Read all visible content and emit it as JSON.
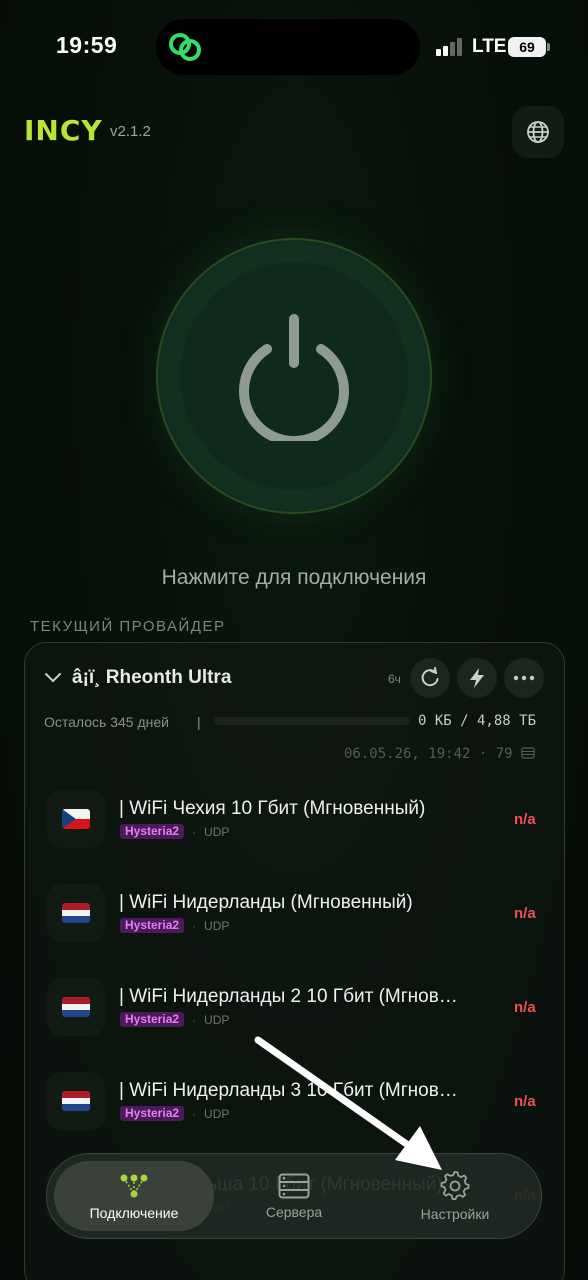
{
  "status_bar": {
    "time": "19:59",
    "network": "LTE",
    "battery": "69"
  },
  "header": {
    "brand": "INCY",
    "version": "v2.1.2"
  },
  "connect": {
    "hint": "Нажмите для подключения"
  },
  "provider": {
    "section_title": "ТЕКУЩИЙ ПРОВАЙДЕР",
    "name": "â¡ï¸ Rheonth Ultra",
    "update_age": "6ч",
    "remaining": "Осталось 345 дней",
    "separator": "|",
    "traffic": "0 КБ / 4,88 ТБ",
    "traffic_used_fraction": 0.0,
    "updated_stamp": "06.05.26, 19:42 · 79"
  },
  "servers": [
    {
      "name": "| WiFi Чехия 10 Гбит (Мгновенный)",
      "protocol": "Hysteria2",
      "network": "UDP",
      "ping": "n/a",
      "flag": "cz"
    },
    {
      "name": "| WiFi Нидерланды (Мгновенный)",
      "protocol": "Hysteria2",
      "network": "UDP",
      "ping": "n/a",
      "flag": "nl"
    },
    {
      "name": "| WiFi Нидерланды 2 10 Гбит (Мгнов…",
      "protocol": "Hysteria2",
      "network": "UDP",
      "ping": "n/a",
      "flag": "nl"
    },
    {
      "name": "| WiFi Нидерланды 3 10 Гбит (Мгнов…",
      "protocol": "Hysteria2",
      "network": "UDP",
      "ping": "n/a",
      "flag": "nl"
    },
    {
      "name": "| WiFi Польша 10 Гбит (Мгновенный)",
      "protocol": "Hysteria2",
      "network": "UDP",
      "ping": "n/a",
      "flag": "pl"
    }
  ],
  "nav": {
    "connection": "Подключение",
    "servers": "Сервера",
    "settings": "Настройки"
  },
  "icons": {
    "island": "link-icon",
    "globe": "globe-icon",
    "power": "power-icon",
    "refresh": "refresh-icon",
    "bolt": "bolt-icon",
    "more": "more-icon",
    "connection": "network-nodes-icon",
    "servers": "server-icon",
    "settings": "gear-icon"
  },
  "colors": {
    "accent": "#b7e534",
    "ping_error": "#ef5050",
    "protocol_badge": "#e57ef0"
  }
}
